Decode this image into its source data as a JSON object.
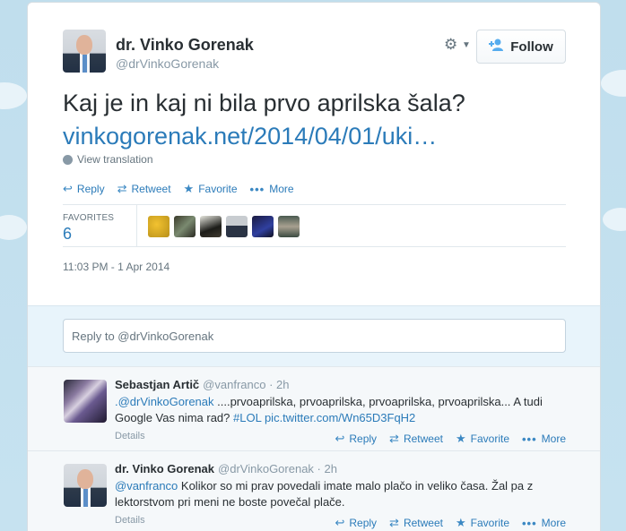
{
  "tweet": {
    "author_name": "dr. Vinko Gorenak",
    "author_handle": "@drVinkoGorenak",
    "follow_label": "Follow",
    "text": "Kaj je in kaj ni bila prvo aprilska šala?",
    "link": "vinkogorenak.net/2014/04/01/uki…",
    "view_translation": "View translation",
    "actions": {
      "reply": "Reply",
      "retweet": "Retweet",
      "favorite": "Favorite",
      "more": "More"
    },
    "favorites_label": "FAVORITES",
    "favorites_count": "6",
    "timestamp": "11:03 PM - 1 Apr 2014"
  },
  "reply_box": {
    "placeholder": "Reply to @drVinkoGorenak"
  },
  "replies": [
    {
      "name": "Sebastjan Artič",
      "meta": "@vanfranco · 2h",
      "mention": ".@drVinkoGorenak",
      "text": " ....prvoaprilska, prvoaprilska, prvoaprilska, prvoaprilska... A tudi Google Vas nima rad? ",
      "hashtag": "#LOL",
      "link": "pic.twitter.com/Wn65D3FqH2",
      "details": "Details"
    },
    {
      "name": "dr. Vinko Gorenak",
      "meta": "@drVinkoGorenak · 2h",
      "mention": "@vanfranco",
      "text": " Kolikor so mi prav povedali imate malo plačo in veliko časa. Žal pa z lektorstvom pri meni ne boste povečal plače.",
      "details": "Details"
    }
  ],
  "colors": {
    "link": "#2b7bb9",
    "muted": "#66757f",
    "background": "#c0deed"
  }
}
